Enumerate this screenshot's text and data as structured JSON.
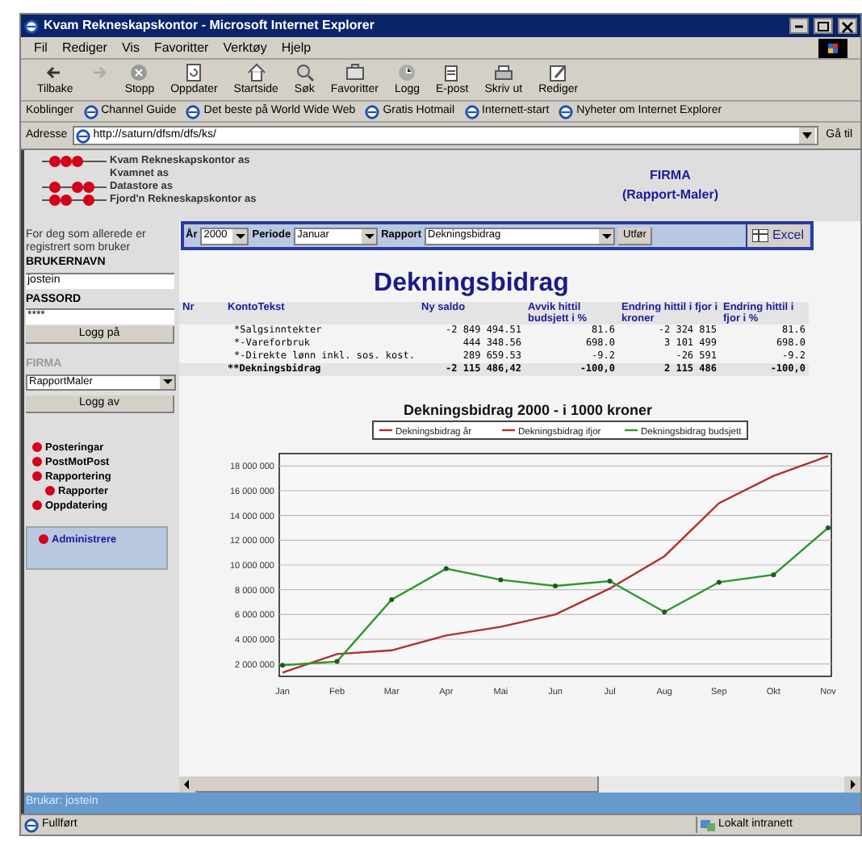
{
  "window": {
    "title": "Kvam Rekneskapskontor - Microsoft Internet Explorer"
  },
  "menu": [
    "Fil",
    "Rediger",
    "Vis",
    "Favoritter",
    "Verktøy",
    "Hjelp"
  ],
  "toolbar": [
    {
      "kind": "back",
      "label": "Tilbake",
      "disabled": false
    },
    {
      "kind": "forward",
      "disabled": true
    },
    {
      "kind": "stop",
      "label": "Stopp",
      "disabled": false
    },
    {
      "kind": "refresh",
      "label": "Oppdater",
      "disabled": false
    },
    {
      "kind": "home",
      "label": "Startside",
      "disabled": false
    },
    {
      "kind": "search",
      "label": "Søk",
      "disabled": false
    },
    {
      "kind": "favorites",
      "label": "Favoritter",
      "disabled": false
    },
    {
      "kind": "history",
      "label": "Logg",
      "disabled": false
    },
    {
      "kind": "mail",
      "label": "E-post",
      "disabled": false
    },
    {
      "kind": "print",
      "label": "Skriv ut",
      "disabled": false
    },
    {
      "kind": "edit",
      "label": "Rediger",
      "disabled": false
    }
  ],
  "links": {
    "label": "Koblinger",
    "items": [
      "Channel Guide",
      "Det beste på World Wide Web",
      "Gratis Hotmail",
      "Internett-start",
      "Nyheter om Internet Explorer"
    ]
  },
  "address": {
    "label": "Adresse",
    "value": "http://saturn/dfsm/dfs/ks/",
    "go": "Gå til"
  },
  "header": {
    "companies": [
      "Kvam Rekneskapskontor as",
      "Kvamnet as",
      "Datastore as",
      "Fjord'n Rekneskapskontor as"
    ],
    "title": "FIRMA",
    "subtitle": "(Rapport-Maler)"
  },
  "sidebar": {
    "intro": "For deg som allerede er registrert som bruker",
    "username_label": "BRUKERNAVN",
    "username": "jostein",
    "password_label": "PASSORD",
    "password": "****",
    "login": "Logg på",
    "firm_label": "FIRMA",
    "firm": "RapportMaler",
    "logout": "Logg av",
    "nav": [
      {
        "label": "Posteringar"
      },
      {
        "label": "PostMotPost"
      },
      {
        "label": "Rapportering",
        "children": [
          {
            "label": "Rapporter"
          }
        ]
      },
      {
        "label": "Oppdatering"
      }
    ],
    "admin": {
      "label": "Administrere",
      "selected": true
    }
  },
  "filter": {
    "year_label": "År",
    "year": "2000",
    "period_label": "Periode",
    "period": "Januar",
    "report_label": "Rapport",
    "report": "Dekningsbidrag",
    "run": "Utfør",
    "excel": "Excel"
  },
  "report": {
    "title": "Dekningsbidrag",
    "columns": [
      "Nr",
      "KontoTekst",
      "Ny saldo",
      "Avvik hittil budsjett i %",
      "Endring hittil i fjor i kroner",
      "Endring hittil i fjor i %"
    ],
    "rows": [
      {
        "kind": "line",
        "cells": [
          "",
          "*Salgsinntekter",
          "-2 849 494.51",
          "81.6",
          "-2 324 815",
          "81.6"
        ]
      },
      {
        "kind": "line",
        "cells": [
          "",
          "*-Vareforbruk",
          "444 348.56",
          "698.0",
          "3 101 499",
          "698.0"
        ]
      },
      {
        "kind": "line",
        "cells": [
          "",
          "*-Direkte lønn inkl. sos. kost.",
          "289 659.53",
          "-9.2",
          "-26 591",
          "-9.2"
        ]
      },
      {
        "kind": "total",
        "cells": [
          "",
          "**Dekningsbidrag",
          "-2 115 486,42",
          "-100,0",
          "2 115 486",
          "-100,0"
        ]
      }
    ],
    "chart_data": {
      "type": "line",
      "title": "Dekningsbidrag 2000 - i 1000 kroner",
      "categories": [
        "Jan",
        "Feb",
        "Mar",
        "Apr",
        "Mai",
        "Jun",
        "Jul",
        "Aug",
        "Sep",
        "Okt",
        "Nov"
      ],
      "ylim": [
        1000000,
        19000000
      ],
      "grid": true,
      "legend": true,
      "yticks": [
        {
          "value": 2000000,
          "label": "2 000 000"
        },
        {
          "value": 4000000,
          "label": "4 000 000"
        },
        {
          "value": 6000000,
          "label": "6 000 000"
        },
        {
          "value": 8000000,
          "label": "8 000 000"
        },
        {
          "value": 10000000,
          "label": "10 000 000"
        },
        {
          "value": 12000000,
          "label": "12 000 000"
        },
        {
          "value": 14000000,
          "label": "14 000 000"
        },
        {
          "value": 16000000,
          "label": "16 000 000"
        },
        {
          "value": 18000000,
          "label": "18 000 000"
        }
      ],
      "series": [
        {
          "name": "Dekningsbidrag år",
          "color": "#b03030",
          "values": [
            1300000,
            2800000,
            3100000,
            4300000,
            5000000,
            6000000,
            8100000,
            10700000,
            15000000,
            17200000,
            18800000
          ]
        },
        {
          "name": "Dekningsbidrag ifjor",
          "color": "#b03030",
          "values": [
            null,
            null,
            null,
            null,
            null,
            null,
            null,
            null,
            null,
            null,
            null
          ]
        },
        {
          "name": "Dekningsbidrag budsjett",
          "color": "#2a9a2a",
          "marker": "circle",
          "values": [
            1900000,
            2200000,
            7200000,
            9700000,
            8800000,
            8300000,
            8700000,
            6200000,
            8600000,
            9200000,
            13000000
          ]
        }
      ]
    }
  },
  "page_status": "Brukar: jostein",
  "status": {
    "text": "Fullført",
    "zone": "Lokalt intranett"
  }
}
